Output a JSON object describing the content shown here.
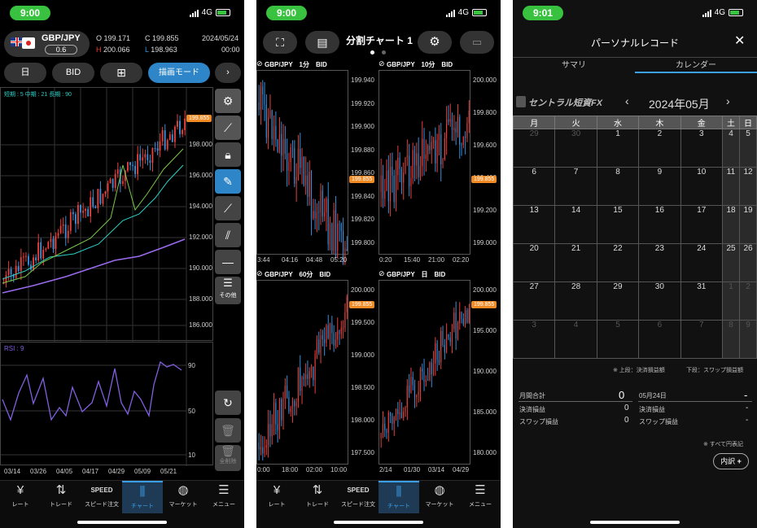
{
  "p1": {
    "time": "9:00",
    "network": "4G",
    "pair": "GBP/JPY",
    "spread": "0.6",
    "open_label": "O",
    "open": "199.171",
    "close_label": "C",
    "close": "199.855",
    "high_label": "H",
    "high": "200.066",
    "low_label": "L",
    "low": "198.963",
    "date": "2024/05/24",
    "clock": "00:00",
    "btn_period": "日",
    "btn_bid": "BID",
    "btn_mode": "描画モード",
    "ma_label": "短期 : 5  中期 : 21  長期 : 90",
    "rsi_label": "RSI : 9",
    "price_badge": "199.855",
    "y_ticks": [
      "198.000",
      "196.000",
      "194.000",
      "192.000",
      "190.000",
      "188.000",
      "186.000"
    ],
    "rsi_ticks": [
      "90",
      "50",
      "10"
    ],
    "x_ticks": [
      "03/14",
      "03/26",
      "04/05",
      "04/17",
      "04/29",
      "05/09",
      "05/21"
    ],
    "tool_other": "その他",
    "tool_delete_all": "全削除"
  },
  "p2": {
    "time": "9:00",
    "network": "4G",
    "title": "分割チャート 1",
    "panes": [
      {
        "title": "GBP/JPY　1分　BID",
        "badge": "199.855",
        "y": [
          "199.940",
          "199.920",
          "199.900",
          "199.880",
          "199.860",
          "199.840",
          "199.820",
          "199.800"
        ],
        "x": [
          "3:44",
          "04:16",
          "04:48",
          "05:20"
        ]
      },
      {
        "title": "GBP/JPY　10分　BID",
        "badge": "199.855",
        "y": [
          "200.000",
          "199.800",
          "199.600",
          "199.400",
          "199.200",
          "199.000"
        ],
        "x": [
          "0:20",
          "15:40",
          "21:00",
          "02:20"
        ]
      },
      {
        "title": "GBP/JPY　60分　BID",
        "badge": "199.855",
        "y": [
          "200.000",
          "199.500",
          "199.000",
          "198.500",
          "198.000",
          "197.500"
        ],
        "x": [
          "0:00",
          "18:00",
          "02:00",
          "10:00"
        ]
      },
      {
        "title": "GBP/JPY　日　BID",
        "badge": "199.855",
        "y": [
          "200.000",
          "195.000",
          "190.000",
          "185.000",
          "180.000"
        ],
        "x": [
          "2/14",
          "01/30",
          "03/14",
          "04/29"
        ]
      }
    ]
  },
  "p3": {
    "time": "9:01",
    "network": "4G",
    "title": "パーソナルレコード",
    "tab_summary": "サマリ",
    "tab_calendar": "カレンダー",
    "brand": "セントラル短資FX",
    "month": "2024年05月",
    "weekdays": [
      "月",
      "火",
      "水",
      "木",
      "金",
      "土",
      "日"
    ],
    "weeks": [
      [
        "29",
        "30",
        "1",
        "2",
        "3",
        "4",
        "5"
      ],
      [
        "6",
        "7",
        "8",
        "9",
        "10",
        "11",
        "12"
      ],
      [
        "13",
        "14",
        "15",
        "16",
        "17",
        "18",
        "19"
      ],
      [
        "20",
        "21",
        "22",
        "23",
        "24",
        "25",
        "26"
      ],
      [
        "27",
        "28",
        "29",
        "30",
        "31",
        "1",
        "2"
      ],
      [
        "3",
        "4",
        "5",
        "6",
        "7",
        "8",
        "9"
      ]
    ],
    "legend_upper": "※ 上段：決済損益額",
    "legend_lower": "下段：スワップ損益額",
    "month_total_label": "月間合計",
    "month_total": "0",
    "settle_label": "決済損益",
    "settle": "0",
    "swap_label": "スワップ損益",
    "swap": "0",
    "day_label": "05月24日",
    "day_total": "-",
    "day_settle": "-",
    "day_swap": "-",
    "yen_note": "※ すべて円表記",
    "detail_btn": "内訳"
  },
  "tabs": [
    "レート",
    "トレード",
    "スピード注文",
    "チャート",
    "マーケット",
    "メニュー"
  ],
  "colors": {
    "up": "#e8413c",
    "down": "#3b8fd9",
    "accent": "#2e86c8",
    "badge": "#f08a24",
    "status_green": "#38c23f"
  }
}
